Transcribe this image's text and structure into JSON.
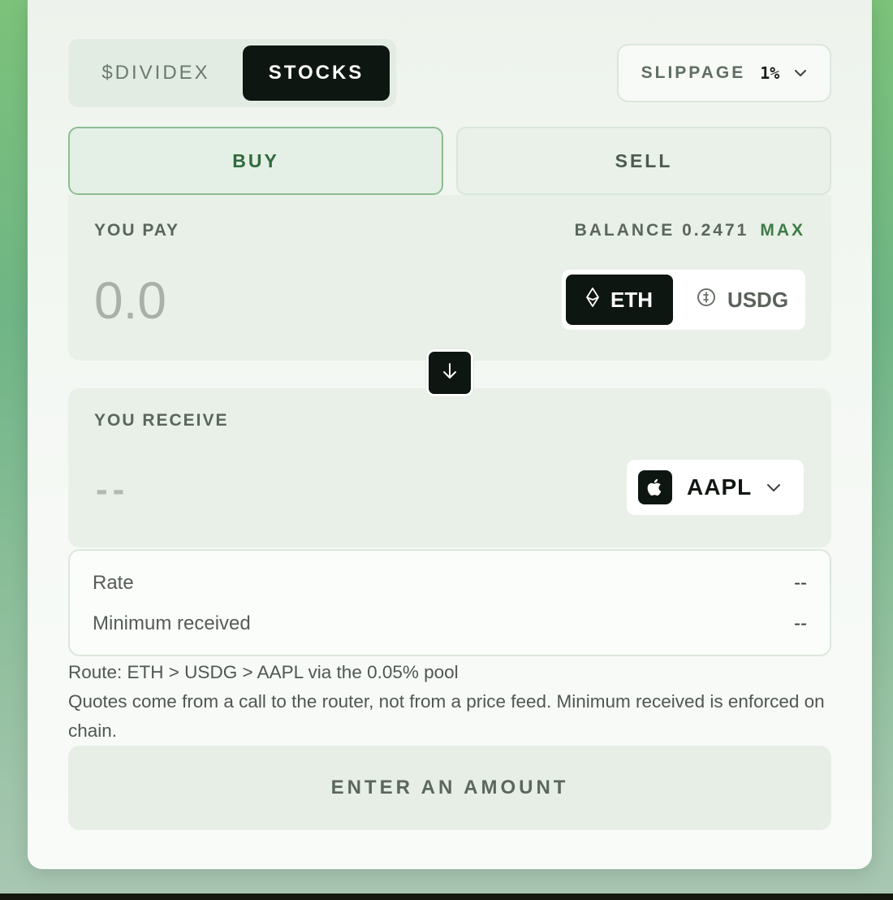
{
  "colors": {
    "accent_green": "#3d7c47",
    "dark": "#0e1611",
    "panel_bg": "#e8f0e7"
  },
  "mode_toggle": {
    "options": [
      "$DIVIDEX",
      "STOCKS"
    ],
    "selected": "STOCKS"
  },
  "slippage": {
    "label": "SLIPPAGE",
    "value": "1%",
    "icon": "chevron-down-icon"
  },
  "side_tabs": {
    "buy": "BUY",
    "sell": "SELL",
    "selected": "BUY"
  },
  "pay": {
    "label": "YOU PAY",
    "balance_text": "BALANCE 0.2471",
    "max_label": "MAX",
    "amount_placeholder": "0.0",
    "tokens": [
      {
        "symbol": "ETH",
        "icon": "ethereum-icon",
        "selected": true
      },
      {
        "symbol": "USDG",
        "icon": "usdg-coin-icon",
        "selected": false
      }
    ]
  },
  "swap_direction_icon": "arrow-down-icon",
  "receive": {
    "label": "YOU RECEIVE",
    "amount": "--",
    "asset": "AAPL",
    "asset_icon": "apple-icon"
  },
  "quote": {
    "rate_label": "Rate",
    "rate_value": "--",
    "min_received_label": "Minimum received",
    "min_received_value": "--"
  },
  "notes": {
    "route": "Route: ETH > USDG > AAPL via the 0.05% pool",
    "disclaimer": "Quotes come from a call to the router, not from a price feed. Minimum received is enforced on chain."
  },
  "cta_label": "ENTER AN AMOUNT"
}
